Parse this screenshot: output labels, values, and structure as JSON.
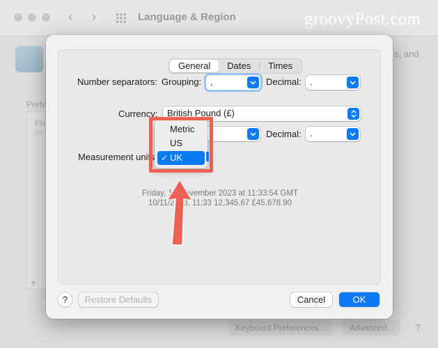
{
  "background": {
    "window_title": "Language & Region",
    "brand_watermark": "groovyPost.com",
    "right_text": "s, and",
    "preferred_label": "Prefe",
    "list_text": "En",
    "list_sub": "En",
    "add_symbol": "+",
    "keyboard_prefs_label": "Keyboard Preferences...",
    "advanced_label": "Advanced...",
    "help_symbol": "?"
  },
  "tabs": [
    {
      "label": "General",
      "active": true
    },
    {
      "label": "Dates",
      "active": false
    },
    {
      "label": "Times",
      "active": false
    }
  ],
  "form": {
    "number_separators_label": "Number separators:",
    "grouping_label": "Grouping:",
    "grouping_value": ",",
    "decimal_label": "Decimal:",
    "decimal_value": ".",
    "currency_label": "Currency:",
    "currency_value": "British Pound (£)",
    "currency_decimal_label": "Decimal:",
    "currency_decimal_value": ".",
    "measurement_label": "Measurement units"
  },
  "measurement_menu": {
    "items": [
      "Metric",
      "US",
      "UK"
    ],
    "selected": "UK",
    "check_glyph": "✓"
  },
  "samples": {
    "date_line": "Friday, 10 November 2023 at 11:33:54 GMT",
    "numbers_line": "10/11/2023, 11:33     12,345.67     £45,678.90"
  },
  "footer": {
    "help_symbol": "?",
    "restore_label": "Restore Defaults",
    "cancel_label": "Cancel",
    "ok_label": "OK"
  },
  "colors": {
    "accent": "#0a7bf5",
    "annotation": "#ee6053"
  }
}
